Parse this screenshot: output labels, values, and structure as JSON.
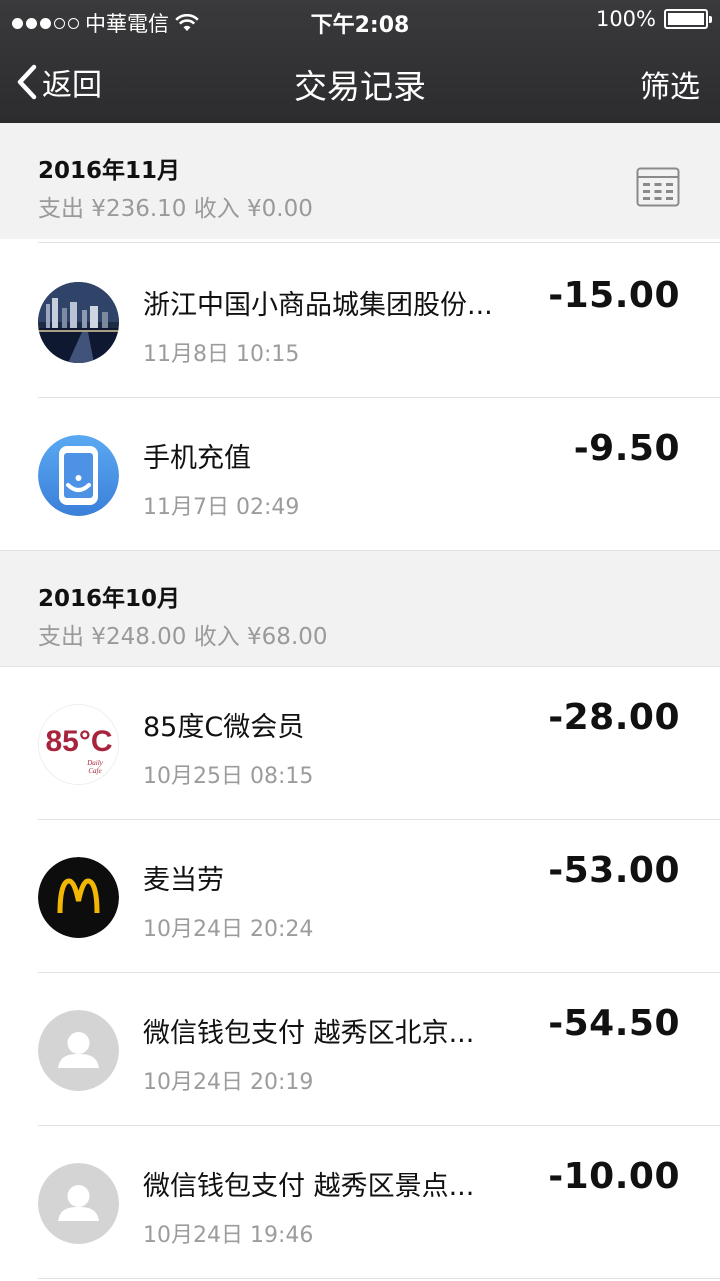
{
  "status_bar": {
    "carrier": "中華電信",
    "time": "下午2:08",
    "battery": "100%",
    "signal_bars": 3,
    "signal_total": 5
  },
  "nav": {
    "back_label": "返回",
    "title": "交易记录",
    "filter_label": "筛选"
  },
  "sections": [
    {
      "month": "2016年11月",
      "summary": "支出 ¥236.10 收入 ¥0.00",
      "items": [
        {
          "name": "浙江中国小商品城集团股份...",
          "time": "11月8日 10:15",
          "amount": "-15.00",
          "icon": "night-city-avatar"
        },
        {
          "name": "手机充值",
          "time": "11月7日 02:49",
          "amount": "-9.50",
          "icon": "phone-recharge-icon"
        }
      ]
    },
    {
      "month": "2016年10月",
      "summary": "支出 ¥248.00 收入 ¥68.00",
      "items": [
        {
          "name": "85度C微会员",
          "time": "10月25日 08:15",
          "amount": "-28.00",
          "icon": "85c-logo",
          "logo_text": "85°C",
          "logo_sub": "Daily Cafe"
        },
        {
          "name": "麦当劳",
          "time": "10月24日 20:24",
          "amount": "-53.00",
          "icon": "mcdonalds-logo"
        },
        {
          "name": "微信钱包支付 越秀区北京...",
          "time": "10月24日 20:19",
          "amount": "-54.50",
          "icon": "default-user-avatar"
        },
        {
          "name": "微信钱包支付 越秀区景点...",
          "time": "10月24日 19:46",
          "amount": "-10.00",
          "icon": "default-user-avatar"
        }
      ]
    }
  ],
  "colors": {
    "nav_bg": "#2c2c2e",
    "section_bg": "#f2f2f2",
    "muted_text": "#9c9c9c",
    "mcd_yellow": "#f2b705",
    "brand_red": "#a8243c",
    "blue_icon": "#4a90e2"
  }
}
